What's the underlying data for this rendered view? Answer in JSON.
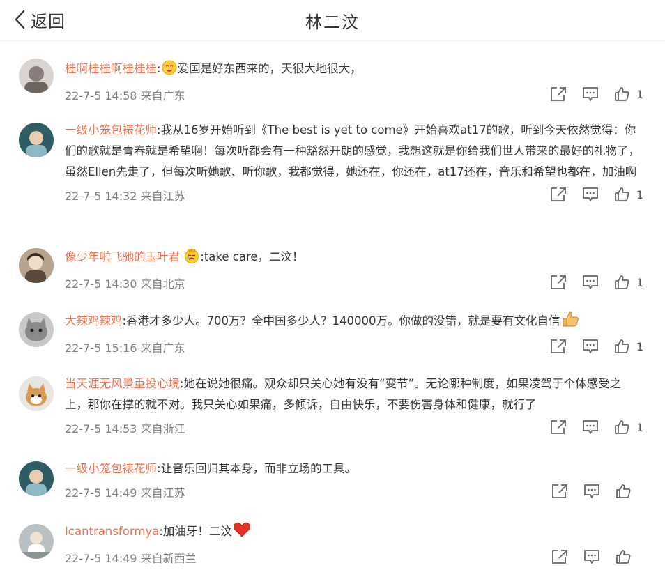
{
  "header": {
    "back_label": "返回",
    "title": "林二汶"
  },
  "comments": [
    {
      "username": "桂啊桂桂啊桂桂桂",
      "sep": ":",
      "text": "爱国是好东西来的，天很大地很大，",
      "time": "22-7-5 14:58",
      "source": "来自广东",
      "likes": "1",
      "emoji": "hug-face-icon",
      "avatar_color": "#b9b2ad"
    },
    {
      "username": "一级小笼包裱花师",
      "sep": ":",
      "text": "我从16岁开始听到《The best is yet to come》开始喜欢at17的歌，听到今天依然觉得：你们的歌就是青春就是希望啊！每次听都会有一种豁然开朗的感觉，我想这就是你给我们世人带来的最好的礼物了，虽然Ellen先走了，但每次听她歌、听你歌，我都觉得，她还在，你还在，at17还在，音乐和希望也都在，加油啊",
      "time": "22-7-5 14:32",
      "source": "来自江苏",
      "likes": "1",
      "avatar_color": "#3a6f78"
    },
    {
      "username": "像少年啦飞驰的玉叶君",
      "sep": ":",
      "text": "take care，二汶！",
      "time": "22-7-5 14:30",
      "source": "来自北京",
      "likes": "1",
      "emoji": "crying-face-icon",
      "avatar_color": "#9c8a7a"
    },
    {
      "username": "大辣鸡辣鸡",
      "sep": ":",
      "text": "香港才多少人。700万？全中国多少人？140000万。你做的没错，就是要有文化自信",
      "time": "22-7-5 15:16",
      "source": "来自广东",
      "likes": "1",
      "emoji_after": "thumbs-up-emoji-icon",
      "avatar_color": "#8f8f8f"
    },
    {
      "username": "当天涯无风景重投心境",
      "sep": ":",
      "text": "她在说她很痛。观众却只关心她有没有“变节”。无论哪种制度，如果凌驾于个体感受之上，那你在撑的就不对。我只关心如果痛，多倾诉，自由快乐，不要伤害身体和健康，就行了",
      "time": "22-7-5 14:53",
      "source": "来自浙江",
      "likes": "1",
      "avatar_color": "#c9a27a"
    },
    {
      "username": "一级小笼包裱花师",
      "sep": ":",
      "text": "让音乐回归其本身，而非立场的工具。",
      "time": "22-7-5 14:49",
      "source": "来自江苏",
      "likes": "",
      "avatar_color": "#3a6f78"
    },
    {
      "username": "Icantransformya",
      "sep": ":",
      "text": "加油牙！二汶",
      "time": "22-7-5 14:49",
      "source": "来自新西兰",
      "likes": "",
      "emoji_after": "heart-icon",
      "avatar_color": "#a8aeb0"
    }
  ],
  "colors": {
    "username": "#eb7350",
    "text": "#333333",
    "meta": "#808080",
    "icon": "#666666"
  }
}
